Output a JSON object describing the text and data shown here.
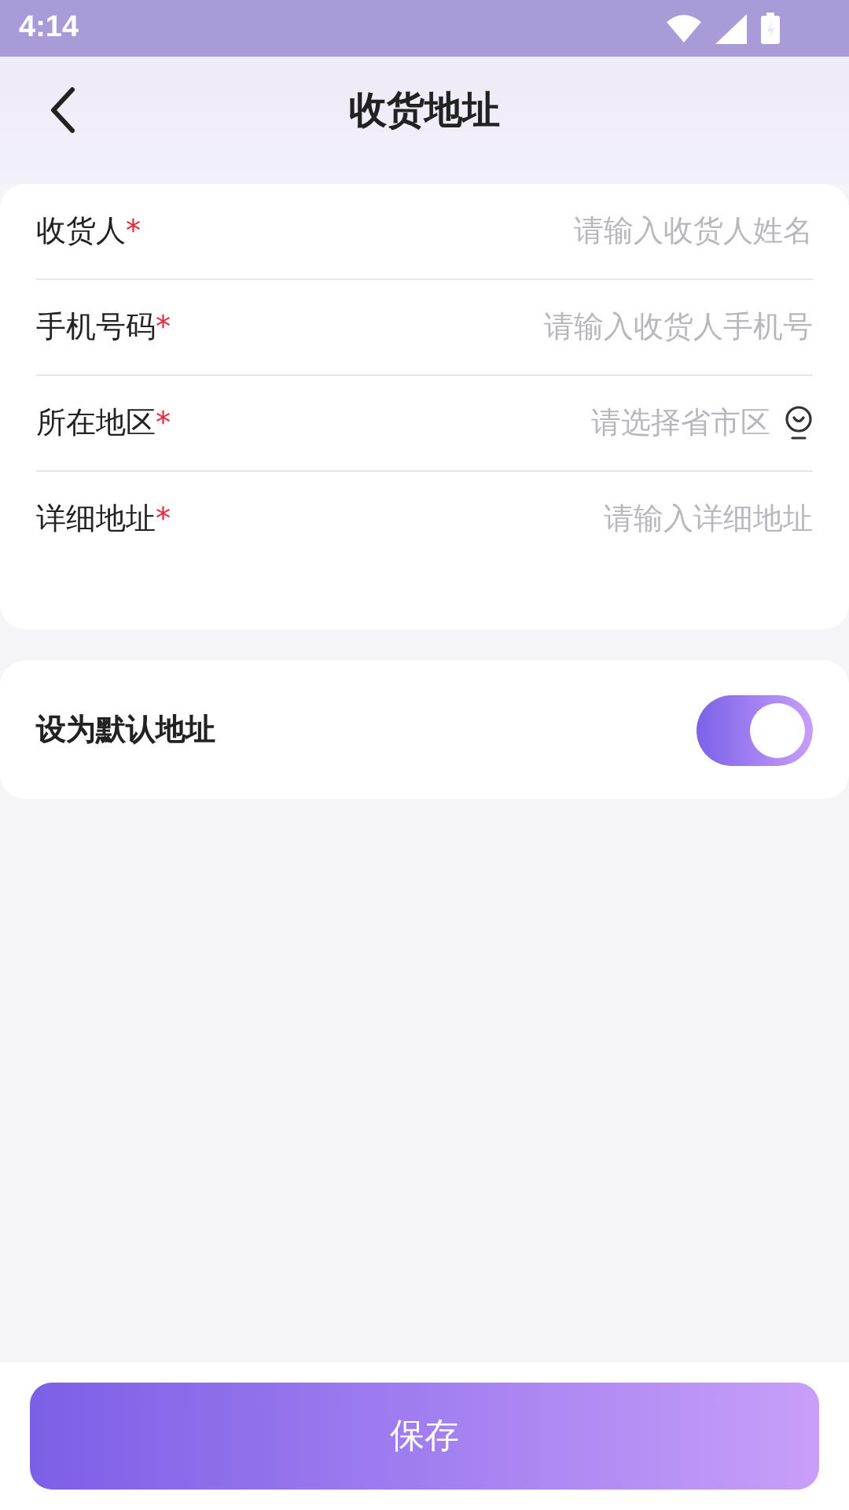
{
  "status_bar": {
    "time": "4:14"
  },
  "header": {
    "title": "收货地址"
  },
  "fields": [
    {
      "kind": "input",
      "label": "收货人",
      "required_mark": "*",
      "placeholder": "请输入收货人姓名"
    },
    {
      "kind": "input",
      "label": "手机号码",
      "required_mark": "*",
      "placeholder": "请输入收货人手机号"
    },
    {
      "kind": "picker",
      "label": "所在地区",
      "required_mark": "*",
      "placeholder": "请选择省市区"
    },
    {
      "kind": "input",
      "label": "详细地址",
      "required_mark": "*",
      "placeholder": "请输入详细地址"
    }
  ],
  "default_setting": {
    "label": "设为默认地址",
    "on": true
  },
  "save_button": {
    "label": "保存"
  }
}
